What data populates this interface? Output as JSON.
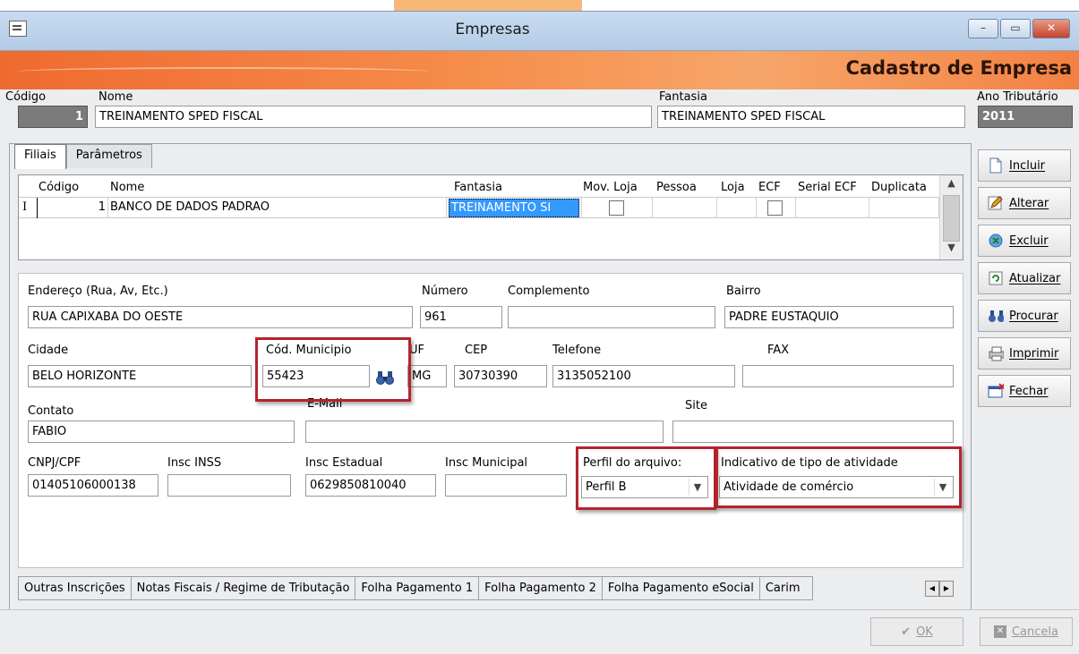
{
  "window": {
    "title": "Empresas",
    "buttons": {
      "minimize": "–",
      "maximize": "▭",
      "close": "✕"
    }
  },
  "banner": {
    "title": "Cadastro de Empresa"
  },
  "header": {
    "codigo_label": "Código",
    "codigo_value": "1",
    "nome_label": "Nome",
    "nome_value": "TREINAMENTO SPED FISCAL",
    "fantasia_label": "Fantasia",
    "fantasia_value": "TREINAMENTO SPED FISCAL",
    "ano_label": "Ano Tributário",
    "ano_value": "2011"
  },
  "tabs": {
    "filiais": "Filiais",
    "parametros": "Parâmetros"
  },
  "grid": {
    "columns": [
      "Código",
      "Nome",
      "Fantasia",
      "Mov. Loja",
      "Pessoa",
      "Loja",
      "ECF",
      "Serial ECF",
      "Duplicata"
    ],
    "row": {
      "cursor": "I",
      "codigo": "1",
      "nome": "BANCO DE DADOS PADRAO",
      "fantasia": "TREINAMENTO SI"
    }
  },
  "form": {
    "endereco_label": "Endereço (Rua, Av,  Etc.)",
    "endereco": "RUA CAPIXABA DO OESTE",
    "numero_label": "Número",
    "numero": "961",
    "complemento_label": "Complemento",
    "complemento": "",
    "bairro_label": "Bairro",
    "bairro": "PADRE EUSTAQUIO",
    "cidade_label": "Cidade",
    "cidade": "BELO HORIZONTE",
    "cod_municipio_label": "Cód. Municipio",
    "cod_municipio": "55423",
    "uf_label": "UF",
    "uf": "MG",
    "cep_label": "CEP",
    "cep": "30730390",
    "telefone_label": "Telefone",
    "telefone": "3135052100",
    "fax_label": "FAX",
    "fax": "",
    "contato_label": "Contato",
    "contato": "FABIO",
    "email_label": "E-Mail",
    "email": "",
    "site_label": "Site",
    "site": "",
    "cnpj_label": "CNPJ/CPF",
    "cnpj": "01405106000138",
    "inss_label": "Insc INSS",
    "inss": "",
    "estadual_label": "Insc Estadual",
    "estadual": "0629850810040",
    "municipal_label": "Insc Municipal",
    "municipal": "",
    "perfil_label": "Perfil do arquivo:",
    "perfil": "Perfil B",
    "atividade_label": "Indicativo de tipo de atividade",
    "atividade": "Atividade de comércio"
  },
  "bottom_tabs": [
    "Outras Inscrições",
    "Notas Fiscais / Regime de Tributação",
    "Folha Pagamento 1",
    "Folha Pagamento 2",
    "Folha Pagamento eSocial",
    "Carim"
  ],
  "sidebar": [
    "Incluir",
    "Alterar",
    "Excluir",
    "Atualizar",
    "Procurar",
    "Imprimir",
    "Fechar"
  ],
  "footer": {
    "ok": "OK",
    "cancel": "Cancela"
  },
  "colors": {
    "accent_orange": "#f28143",
    "highlight_red": "#b3242e",
    "selection_blue": "#3399ff"
  }
}
